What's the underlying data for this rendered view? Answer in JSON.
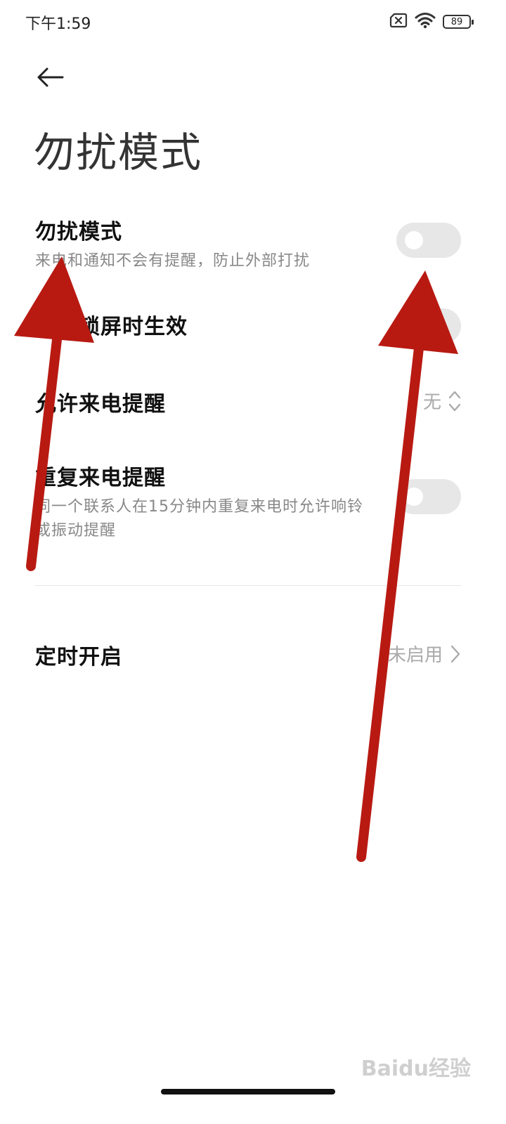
{
  "status_bar": {
    "time": "下午1:59",
    "battery": "89"
  },
  "header": {
    "title": "勿扰模式"
  },
  "settings": {
    "dnd": {
      "title": "勿扰模式",
      "desc": "来电和通知不会有提醒，防止外部打扰",
      "enabled": false
    },
    "lockscreen_only": {
      "title": "仅在锁屏时生效",
      "enabled": false
    },
    "allow_calls": {
      "title": "允许来电提醒",
      "value": "无"
    },
    "repeat_calls": {
      "title": "重复来电提醒",
      "desc_line1": "同一个联系人在15分钟内重复来电时允许响铃",
      "desc_line2": "或振动提醒",
      "enabled": false
    },
    "schedule": {
      "title": "定时开启",
      "value": "未启用"
    }
  },
  "watermark": {
    "text": "Baidu经验"
  },
  "colors": {
    "annotation_arrow": "#b81a12",
    "toggle_off": "#e7e7e7",
    "secondary_text": "#888888"
  },
  "icons": {
    "back": "arrow-left-icon",
    "wifi": "wifi-icon",
    "sim": "no-sim-icon",
    "battery": "battery-icon",
    "updown": "chevron-updown-icon",
    "right": "chevron-right-icon"
  }
}
